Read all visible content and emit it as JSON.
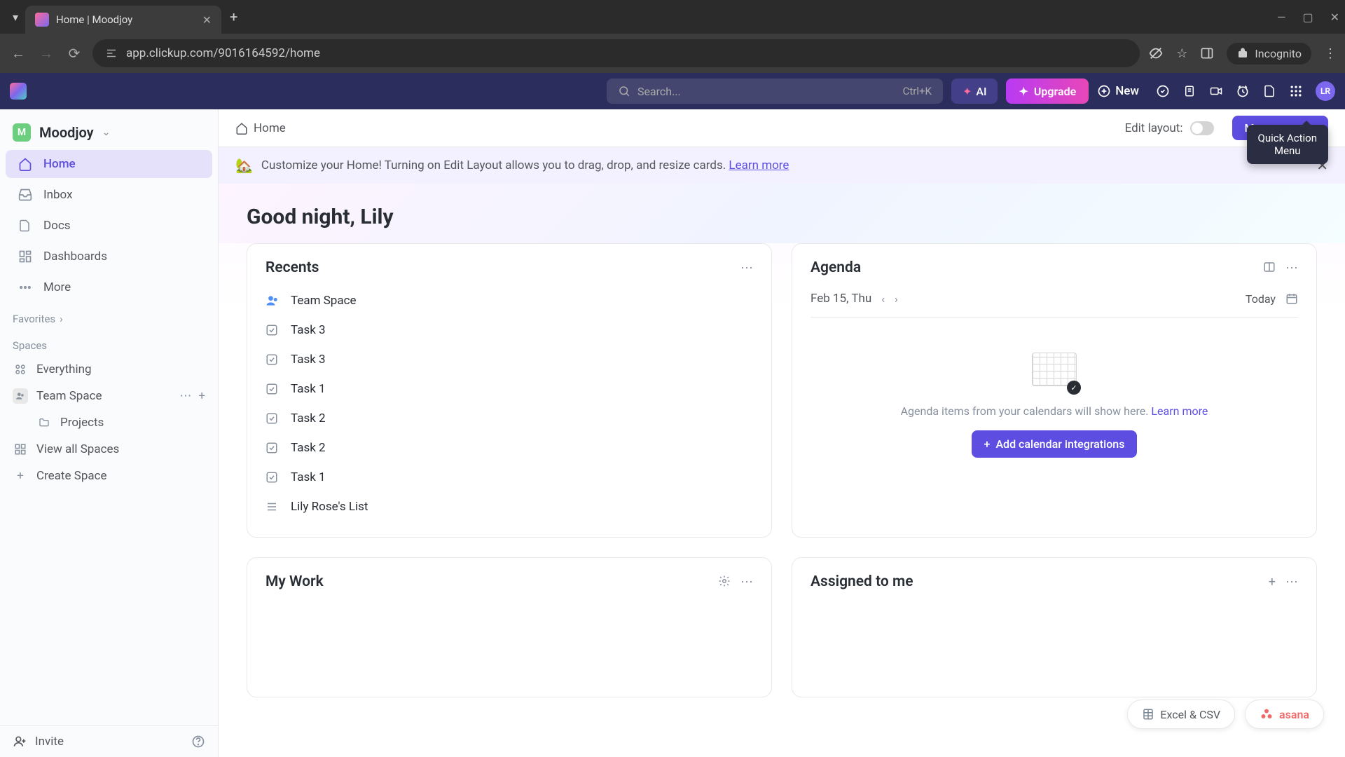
{
  "browser": {
    "tab_title": "Home | Moodjoy",
    "url": "app.clickup.com/9016164592/home",
    "incognito_label": "Incognito"
  },
  "header": {
    "search_placeholder": "Search...",
    "search_shortcut": "Ctrl+K",
    "ai_label": "AI",
    "upgrade_label": "Upgrade",
    "new_label": "New",
    "avatar_initials": "LR"
  },
  "tooltip": {
    "line1": "Quick Action",
    "line2": "Menu"
  },
  "sidebar": {
    "workspace_initial": "M",
    "workspace_name": "Moodjoy",
    "nav": {
      "home": "Home",
      "inbox": "Inbox",
      "docs": "Docs",
      "dashboards": "Dashboards",
      "more": "More"
    },
    "favorites_label": "Favorites",
    "spaces_label": "Spaces",
    "everything": "Everything",
    "team_space": "Team Space",
    "projects": "Projects",
    "view_all": "View all Spaces",
    "create_space": "Create Space",
    "invite": "Invite"
  },
  "content_header": {
    "breadcrumb": "Home",
    "edit_layout_label": "Edit layout:",
    "manage_label": "Manage cards"
  },
  "banner": {
    "text": "Customize your Home! Turning on Edit Layout allows you to drag, drop, and resize cards.",
    "link": "Learn more"
  },
  "greeting": "Good night, Lily",
  "recents": {
    "title": "Recents",
    "items": [
      {
        "label": "Team Space",
        "type": "space"
      },
      {
        "label": "Task 3",
        "type": "task"
      },
      {
        "label": "Task 3",
        "type": "task"
      },
      {
        "label": "Task 1",
        "type": "task"
      },
      {
        "label": "Task 2",
        "type": "task"
      },
      {
        "label": "Task 2",
        "type": "task"
      },
      {
        "label": "Task 1",
        "type": "task"
      },
      {
        "label": "Lily Rose's List",
        "type": "list"
      }
    ]
  },
  "agenda": {
    "title": "Agenda",
    "date": "Feb 15, Thu",
    "today_label": "Today",
    "empty_text": "Agenda items from your calendars will show here.",
    "empty_link": "Learn more",
    "add_button": "Add calendar integrations"
  },
  "my_work": {
    "title": "My Work"
  },
  "assigned": {
    "title": "Assigned to me"
  },
  "floating": {
    "excel_label": "Excel & CSV",
    "asana_label": "asana"
  }
}
